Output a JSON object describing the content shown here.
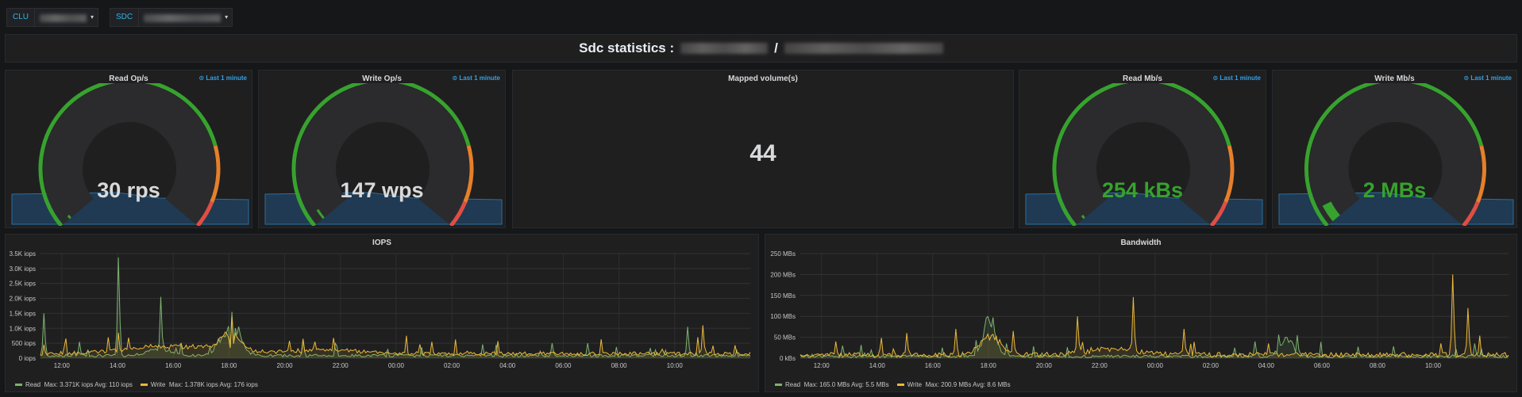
{
  "vars": [
    {
      "label": "CLU"
    },
    {
      "label": "SDC"
    }
  ],
  "header": {
    "title": "Sdc statistics :",
    "separator": "/"
  },
  "colors": {
    "green": "#37a22e",
    "orange": "#e5802a",
    "red": "#e24d42",
    "blue_fill": "#1f3a52",
    "read": "#7eb26d",
    "write": "#eab839",
    "time": "#33a2e5"
  },
  "gauges": [
    {
      "title": "Read Op/s",
      "time": "Last 1 minute",
      "value_text": "30 rps",
      "value_color": "#d8d9da",
      "fraction": 0.01
    },
    {
      "title": "Write Op/s",
      "time": "Last 1 minute",
      "value_text": "147 wps",
      "value_color": "#d8d9da",
      "fraction": 0.03
    },
    {
      "title": "Read Mb/s",
      "time": "Last 1 minute",
      "value_text": "254 kBs",
      "value_color": "#37a22e",
      "fraction": 0.01
    },
    {
      "title": "Write Mb/s",
      "time": "Last 1 minute",
      "value_text": "2 MBs",
      "value_color": "#37a22e",
      "fraction": 0.05
    }
  ],
  "mapped": {
    "title": "Mapped volume(s)",
    "value": "44"
  },
  "chart_data": [
    {
      "type": "line",
      "title": "IOPS",
      "x_ticks": [
        "12:00",
        "14:00",
        "16:00",
        "18:00",
        "20:00",
        "22:00",
        "00:00",
        "02:00",
        "04:00",
        "06:00",
        "08:00",
        "10:00"
      ],
      "y_ticks": [
        "0 iops",
        "500 iops",
        "1.0K iops",
        "1.5K iops",
        "2.0K iops",
        "2.5K iops",
        "3.0K iops",
        "3.5K iops"
      ],
      "ylim": [
        0,
        3500
      ],
      "series": [
        {
          "name": "Read",
          "legend": "Max: 3.371K iops   Avg: 110 iops",
          "color": "#7eb26d"
        },
        {
          "name": "Write",
          "legend": "Max: 1.378K iops   Avg: 176 iops",
          "color": "#eab839"
        }
      ]
    },
    {
      "type": "line",
      "title": "Bandwidth",
      "x_ticks": [
        "12:00",
        "14:00",
        "16:00",
        "18:00",
        "20:00",
        "22:00",
        "00:00",
        "02:00",
        "04:00",
        "06:00",
        "08:00",
        "10:00"
      ],
      "y_ticks": [
        "0 kBs",
        "50 MBs",
        "100 MBs",
        "150 MBs",
        "200 MBs",
        "250 MBs"
      ],
      "ylim": [
        0,
        250
      ],
      "series": [
        {
          "name": "Read",
          "legend": "Max: 165.0 MBs   Avg: 5.5 MBs",
          "color": "#7eb26d"
        },
        {
          "name": "Write",
          "legend": "Max: 200.9 MBs   Avg: 8.6 MBs",
          "color": "#eab839"
        }
      ]
    }
  ]
}
